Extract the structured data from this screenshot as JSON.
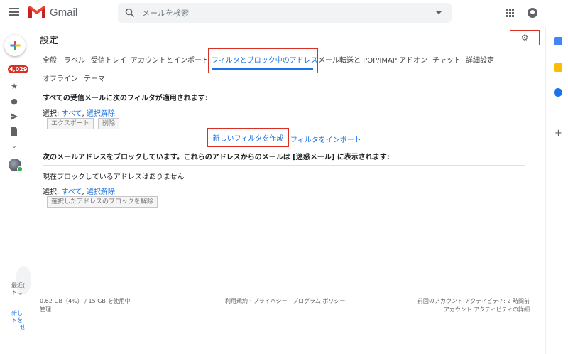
{
  "header": {
    "app_name": "Gmail",
    "search_placeholder": "メールを検索"
  },
  "left_rail": {
    "badge_count": "4,029",
    "partial_text_1": "最近(",
    "partial_text_2": "トは",
    "partial_link_1": "新し",
    "partial_link_2": "トを",
    "partial_link_3": "せ"
  },
  "settings": {
    "title": "設定",
    "tabs": [
      {
        "label": "全般"
      },
      {
        "label": "ラベル"
      },
      {
        "label": "受信トレイ"
      },
      {
        "label": "アカウントとインポート"
      },
      {
        "label": "フィルタとブロック中のアドレス"
      },
      {
        "label": "メール転送と POP/IMAP"
      },
      {
        "label": "アドオン"
      },
      {
        "label": "チャット"
      },
      {
        "label": "詳細設定"
      },
      {
        "label": "オフライン"
      },
      {
        "label": "テーマ"
      }
    ],
    "active_tab": "フィルタとブロック中のアドレス",
    "filters_heading": "すべての受信メールに次のフィルタが適用されます:",
    "select_label": "選択:",
    "select_all": "すべて",
    "select_none": "選択解除",
    "export_btn": "エクスポート",
    "delete_btn": "削除",
    "create_filter": "新しいフィルタを作成",
    "import_filter": "フィルタをインポート",
    "blocked_heading": "次のメールアドレスをブロックしています。これらのアドレスからのメールは [迷惑メール] に表示されます:",
    "no_blocked": "現在ブロックしているアドレスはありません",
    "unblock_btn": "選択したアドレスのブロックを解除"
  },
  "footer": {
    "storage": "0.62 GB（4%） / 15 GB を使用中",
    "manage": "管理",
    "links": "利用規約 · プライバシー · プログラム ポリシー",
    "activity": "前回のアカウント アクティビティ: 2 時間前",
    "activity_details": "アカウント アクティビティの詳細"
  },
  "colors": {
    "accent": "#1a73e8",
    "highlight_box": "#d93025",
    "badge": "#d93025"
  }
}
